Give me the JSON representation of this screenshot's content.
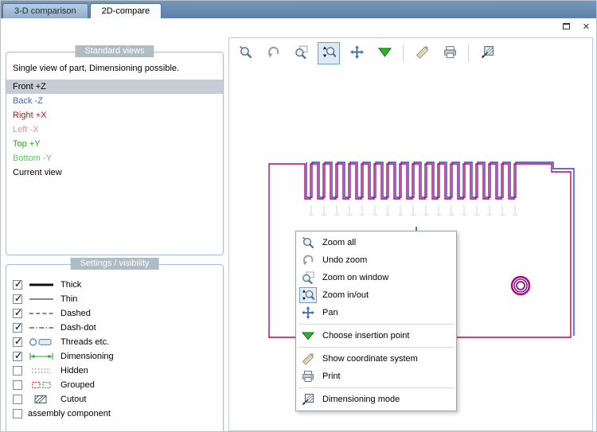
{
  "window_controls": {
    "close_glyph": "✕"
  },
  "tabs": [
    {
      "label": "3-D comparison",
      "active": false
    },
    {
      "label": "2D-compare",
      "active": true
    }
  ],
  "standard_views": {
    "header": "Standard views",
    "description": "Single view of part, Dimensioning possible.",
    "items": [
      {
        "label": "Front +Z",
        "color": "#000000",
        "selected": true
      },
      {
        "label": "Back -Z",
        "color": "#3b64c8"
      },
      {
        "label": "Right +X",
        "color": "#b01818"
      },
      {
        "label": "Left -X",
        "color": "#e89090"
      },
      {
        "label": "Top +Y",
        "color": "#2f9e2f"
      },
      {
        "label": "Bottom -Y",
        "color": "#5cc85c"
      },
      {
        "label": "Current view",
        "color": "#000000"
      }
    ]
  },
  "settings": {
    "header": "Settings / visibility",
    "items": [
      {
        "label": "Thick",
        "checked": true,
        "icon": "thick-line-icon"
      },
      {
        "label": "Thin",
        "checked": true,
        "icon": "thin-line-icon"
      },
      {
        "label": "Dashed",
        "checked": true,
        "icon": "dashed-line-icon"
      },
      {
        "label": "Dash-dot",
        "checked": true,
        "icon": "dash-dot-line-icon"
      },
      {
        "label": "Threads etc.",
        "checked": true,
        "icon": "threads-icon"
      },
      {
        "label": "Dimensioning",
        "checked": true,
        "icon": "dimensioning-icon"
      },
      {
        "label": "Hidden",
        "checked": false,
        "icon": "hidden-icon"
      },
      {
        "label": "Grouped",
        "checked": false,
        "icon": "grouped-icon"
      },
      {
        "label": "Cutout",
        "checked": false,
        "icon": "cutout-icon"
      },
      {
        "label": "assembly component",
        "checked": false,
        "icon": null
      }
    ]
  },
  "toolbar": {
    "buttons": [
      {
        "name": "zoom-all",
        "icon": "zoom-all-icon",
        "pressed": false
      },
      {
        "name": "undo-zoom",
        "icon": "undo-zoom-icon",
        "pressed": false
      },
      {
        "name": "zoom-on-window",
        "icon": "zoom-window-icon",
        "pressed": false
      },
      {
        "name": "zoom-in-out",
        "icon": "zoom-in-out-icon",
        "pressed": true
      },
      {
        "name": "pan",
        "icon": "pan-icon",
        "pressed": false
      },
      {
        "name": "choose-insertion-point",
        "icon": "green-triangle-icon",
        "pressed": false
      },
      {
        "name": "show-coordinate-system",
        "icon": "ruler-icon",
        "pressed": false
      },
      {
        "name": "print",
        "icon": "printer-icon",
        "pressed": false
      },
      {
        "name": "dimensioning-mode",
        "icon": "dimensioning-mode-icon",
        "pressed": false
      }
    ]
  },
  "context_menu": {
    "items": [
      {
        "label": "Zoom all",
        "icon": "zoom-all-icon"
      },
      {
        "label": "Undo zoom",
        "icon": "undo-zoom-icon"
      },
      {
        "label": "Zoom on window",
        "icon": "zoom-window-icon"
      },
      {
        "label": "Zoom in/out",
        "icon": "zoom-in-out-icon",
        "highlighted": true
      },
      {
        "label": "Pan",
        "icon": "pan-icon"
      },
      {
        "label": "Choose insertion point",
        "icon": "green-triangle-icon"
      },
      {
        "label": "Show coordinate system",
        "icon": "ruler-icon"
      },
      {
        "label": "Print",
        "icon": "printer-icon"
      },
      {
        "label": "Dimensioning mode",
        "icon": "dimensioning-mode-icon"
      }
    ]
  },
  "drawing": {
    "colors": {
      "reference_outline": "#c00060",
      "compare_outline": "#3a3ac8",
      "insertion_marker": "#2aa52a",
      "dimension_hints": "#cfd4d8"
    }
  },
  "colors": {
    "tab_bar": "#6286ac",
    "panel_border": "#9dbfdf",
    "header_badge_bg": "#aebcc4",
    "selection_bg": "#c6cdd4",
    "pressed_border": "#6f9ecf",
    "pressed_bg": "#dde9f7"
  }
}
